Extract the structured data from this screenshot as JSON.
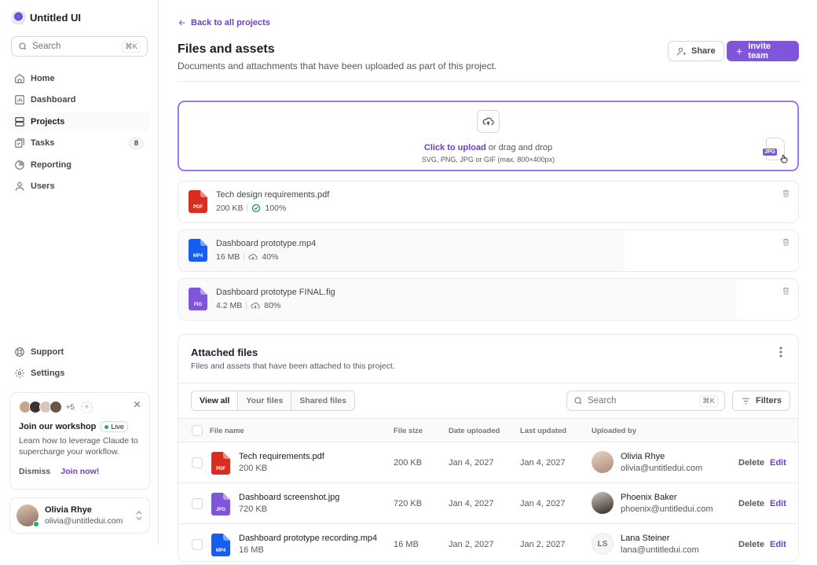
{
  "app": {
    "name": "Untitled UI"
  },
  "sidebar": {
    "search_placeholder": "Search",
    "search_shortcut": "⌘K",
    "items": [
      {
        "label": "Home",
        "icon": "home-icon"
      },
      {
        "label": "Dashboard",
        "icon": "dashboard-icon"
      },
      {
        "label": "Projects",
        "icon": "projects-icon",
        "active": true
      },
      {
        "label": "Tasks",
        "icon": "tasks-icon",
        "badge": "8"
      },
      {
        "label": "Reporting",
        "icon": "pie-chart-icon"
      },
      {
        "label": "Users",
        "icon": "users-icon"
      }
    ],
    "footer_items": [
      {
        "label": "Support",
        "icon": "lifebuoy-icon"
      },
      {
        "label": "Settings",
        "icon": "gear-icon"
      }
    ],
    "workshop": {
      "more_count": "+5",
      "title": "Join our workshop",
      "badge": "Live",
      "text": "Learn how to leverage Claude to supercharge your workflow.",
      "dismiss": "Dismiss",
      "join": "Join now!"
    },
    "user": {
      "name": "Olivia Rhye",
      "email": "olivia@untitledui.com"
    }
  },
  "header": {
    "back_link": "Back to all projects",
    "title": "Files and assets",
    "subtitle": "Documents and attachments that have been uploaded as part of this project.",
    "share": "Share",
    "invite": "Invite team"
  },
  "upload": {
    "click": "Click to upload",
    "rest": "or drag and drop",
    "hint": "SVG, PNG, JPG or GIF (max. 800×400px)",
    "drag_file_type": "JPG"
  },
  "uploads": [
    {
      "name": "Tech design requirements.pdf",
      "size": "200 KB",
      "progress": "100%",
      "type": "PDF",
      "color": "#d92d20",
      "done": true,
      "fraction": 0
    },
    {
      "name": "Dashboard prototype.mp4",
      "size": "16 MB",
      "progress": "40%",
      "type": "MP4",
      "color": "#155eef",
      "done": false,
      "fraction": 0.72
    },
    {
      "name": "Dashboard prototype FINAL.fig",
      "size": "4.2 MB",
      "progress": "80%",
      "type": "FIG",
      "color": "#7f56d9",
      "done": false,
      "fraction": 0.9
    }
  ],
  "attached": {
    "title": "Attached files",
    "subtitle": "Files and assets that have been attached to this project.",
    "tabs": [
      "View all",
      "Your files",
      "Shared files"
    ],
    "search_placeholder": "Search",
    "search_shortcut": "⌘K",
    "filters": "Filters",
    "columns": [
      "File name",
      "File size",
      "Date uploaded",
      "Last updated",
      "Uploaded by"
    ],
    "rows": [
      {
        "name": "Tech requirements.pdf",
        "size": "200 KB",
        "type": "PDF",
        "color": "#d92d20",
        "uploaded": "Jan 4, 2027",
        "updated": "Jan 4, 2027",
        "user": "Olivia Rhye",
        "email": "olivia@untitledui.com",
        "delete": "Delete",
        "edit": "Edit"
      },
      {
        "name": "Dashboard screenshot.jpg",
        "size": "720 KB",
        "type": "JPG",
        "color": "#7f56d9",
        "uploaded": "Jan 4, 2027",
        "updated": "Jan 4, 2027",
        "user": "Phoenix Baker",
        "email": "phoenix@untitledui.com",
        "delete": "Delete",
        "edit": "Edit"
      },
      {
        "name": "Dashboard prototype recording.mp4",
        "size": "16 MB",
        "type": "MP4",
        "color": "#155eef",
        "uploaded": "Jan 2, 2027",
        "updated": "Jan 2, 2027",
        "user": "Lana Steiner",
        "initials": "LS",
        "email": "lana@untitledui.com",
        "delete": "Delete",
        "edit": "Edit"
      }
    ]
  }
}
